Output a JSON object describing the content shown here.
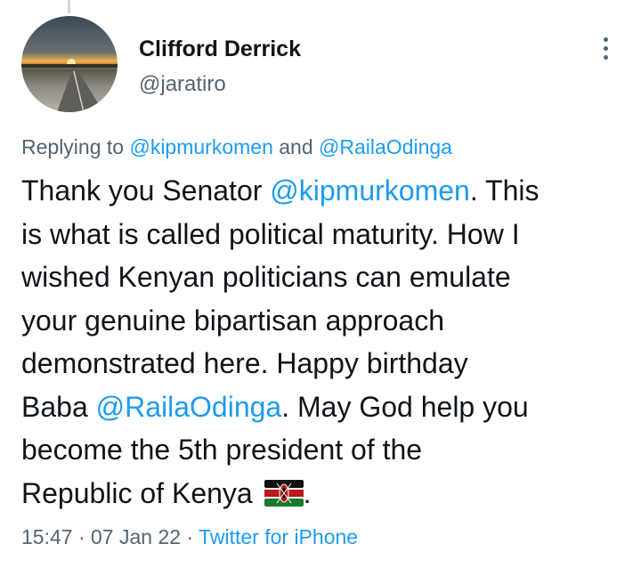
{
  "author": {
    "name": "Clifford Derrick",
    "handle": "@jaratiro"
  },
  "replying": {
    "prefix": "Replying to",
    "mention1": "@kipmurkomen",
    "conjunction": "and",
    "mention2": "@RailaOdinga"
  },
  "tweet": {
    "text1": "Thank you Senator",
    "mention1": "@kipmurkomen",
    "text2_line1": ". This",
    "text2_line2": "is what is called political maturity. How I",
    "text2_line3": "wished Kenyan politicians can emulate",
    "text2_line4": "your genuine bipartisan approach",
    "text2_line5": "demonstrated here. Happy birthday",
    "text2_line6": "Baba",
    "mention2": "@RailaOdinga",
    "text3_line1": ". May God help you",
    "text3_line2": "become the 5th president of the",
    "text3_line3": "Republic of Kenya",
    "text4": ".",
    "flag_emoji": "kenya-flag-icon"
  },
  "meta": {
    "time": "15:47",
    "sep1": "·",
    "date": "07 Jan 22",
    "sep2": "·",
    "source": "Twitter for iPhone"
  },
  "colors": {
    "link": "#1d9bf0",
    "secondary_text": "#536471",
    "primary_text": "#0f1419"
  }
}
